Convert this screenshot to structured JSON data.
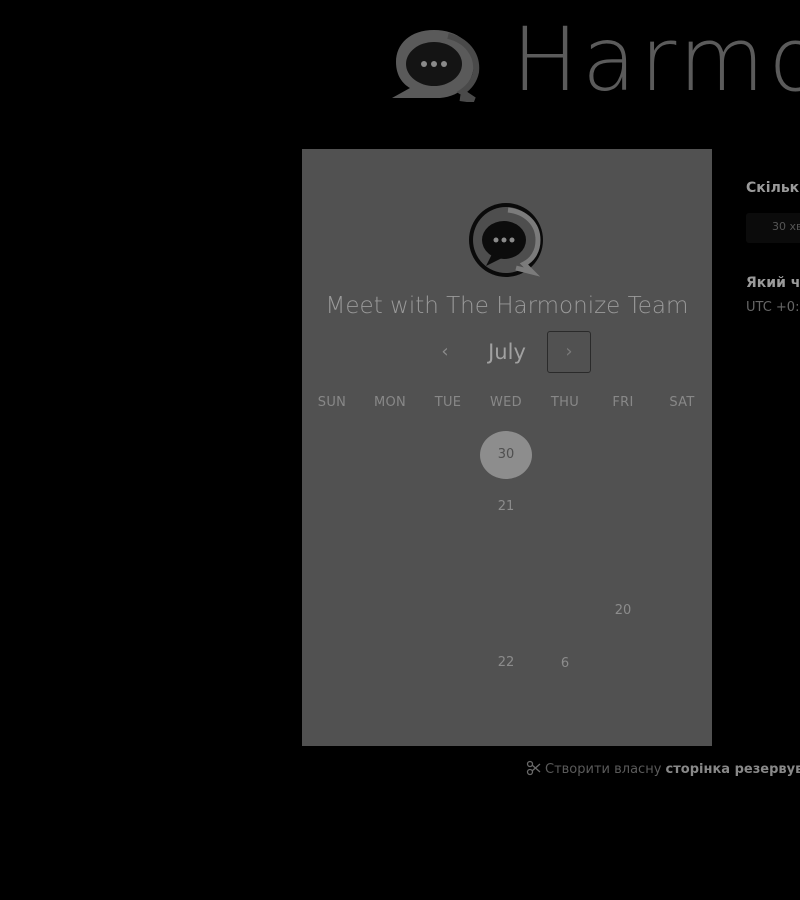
{
  "brand": {
    "name": "Harmo",
    "logo": "chat-bubble-logo-icon"
  },
  "panel": {
    "avatar": "chat-bubble-logo-icon",
    "title": "Meet with The Harmonize Team",
    "month": "July",
    "prev_icon": "‹",
    "next_icon": "›",
    "weekdays": [
      "SUN",
      "MON",
      "TUE",
      "WED",
      "THU",
      "FRI",
      "SAT"
    ],
    "days": [
      {
        "label": "30",
        "selected": true
      },
      {
        "label": "21",
        "selected": false
      },
      {
        "label": "20",
        "selected": false
      },
      {
        "label": "22",
        "selected": false
      },
      {
        "label": "6",
        "selected": false
      }
    ]
  },
  "side": {
    "duration_heading": "Скільк",
    "duration_value": "30 хв",
    "time_heading": "Який ч",
    "timezone": "UTC +0:"
  },
  "footer": {
    "icon": "scissors-icon",
    "text": "Створити власну",
    "link": "сторінка резервува"
  },
  "colors": {
    "panel": "#515151",
    "background": "#000000",
    "selected_day": "#8d8d8d"
  }
}
